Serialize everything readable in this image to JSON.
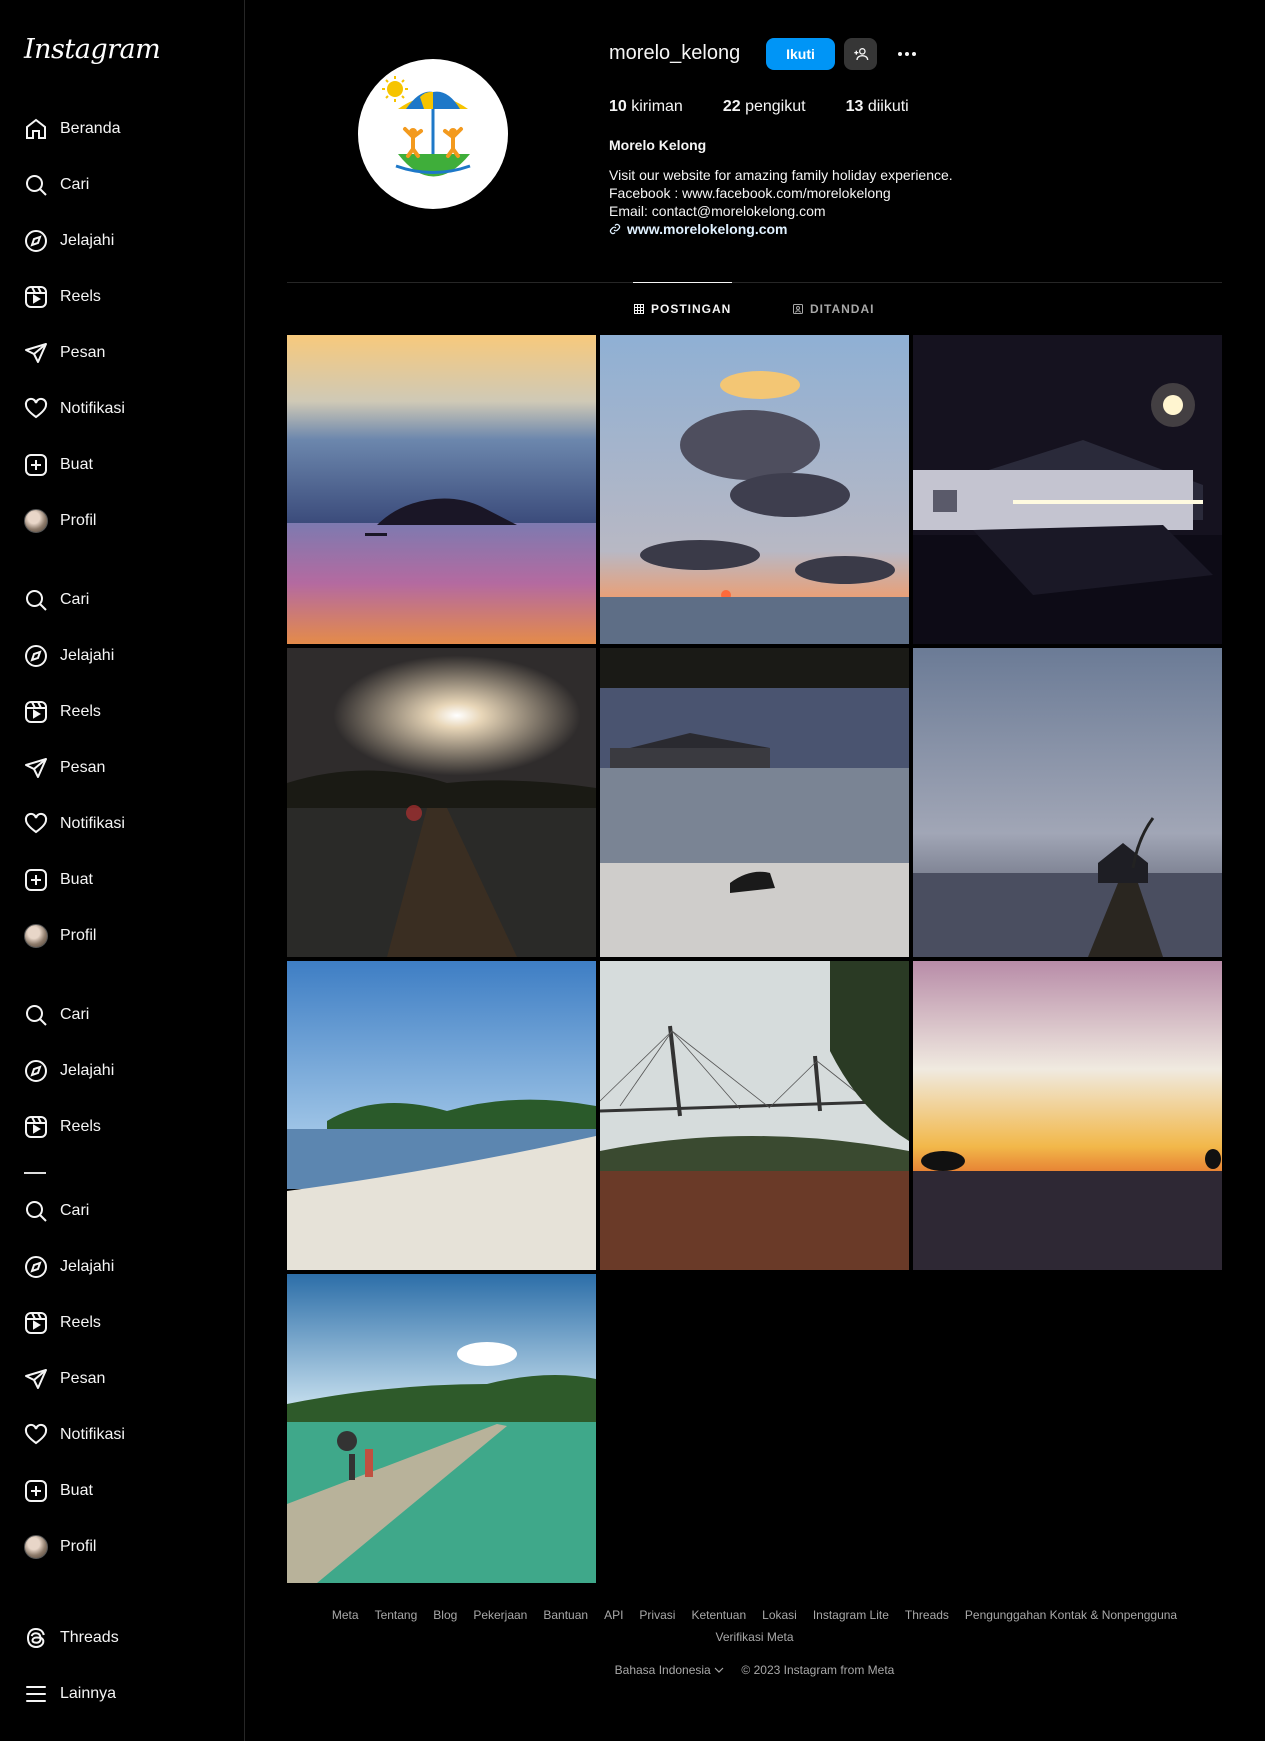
{
  "app": {
    "logo": "Instagram"
  },
  "sidebar": {
    "items": [
      {
        "label": "Beranda",
        "icon": "home-icon"
      },
      {
        "label": "Cari",
        "icon": "search-icon"
      },
      {
        "label": "Jelajahi",
        "icon": "compass-icon"
      },
      {
        "label": "Reels",
        "icon": "reels-icon"
      },
      {
        "label": "Pesan",
        "icon": "send-icon"
      },
      {
        "label": "Notifikasi",
        "icon": "heart-icon"
      },
      {
        "label": "Buat",
        "icon": "plus-square-icon"
      },
      {
        "label": "Profil",
        "icon": "avatar"
      },
      {
        "label": "Cari",
        "icon": "search-icon"
      },
      {
        "label": "Jelajahi",
        "icon": "compass-icon"
      },
      {
        "label": "Reels",
        "icon": "reels-icon"
      },
      {
        "label": "Pesan",
        "icon": "send-icon"
      },
      {
        "label": "Notifikasi",
        "icon": "heart-icon"
      },
      {
        "label": "Buat",
        "icon": "plus-square-icon"
      },
      {
        "label": "Profil",
        "icon": "avatar"
      },
      {
        "label": "Cari",
        "icon": "search-icon"
      },
      {
        "label": "Jelajahi",
        "icon": "compass-icon"
      },
      {
        "label": "Reels",
        "icon": "reels-icon"
      },
      {
        "label": "Cari",
        "icon": "search-icon"
      },
      {
        "label": "Jelajahi",
        "icon": "compass-icon"
      },
      {
        "label": "Reels",
        "icon": "reels-icon"
      },
      {
        "label": "Pesan",
        "icon": "send-icon"
      },
      {
        "label": "Notifikasi",
        "icon": "heart-icon"
      },
      {
        "label": "Buat",
        "icon": "plus-square-icon"
      },
      {
        "label": "Profil",
        "icon": "avatar"
      }
    ],
    "threads": "Threads",
    "more": "Lainnya"
  },
  "profile": {
    "username": "morelo_kelong",
    "follow_label": "Ikuti",
    "posts_count": "10",
    "posts_label": "kiriman",
    "followers_count": "22",
    "followers_label": "pengikut",
    "following_count": "13",
    "following_label": "diikuti",
    "full_name": "Morelo Kelong",
    "bio_line1": "Visit our website for amazing family holiday experience.",
    "bio_line2": "Facebook : www.facebook.com/morelokelong",
    "bio_line3": "Email: contact@morelokelong.com",
    "website": "www.morelokelong.com"
  },
  "tabs": {
    "posts": "POSTINGAN",
    "tagged": "DITANDAI"
  },
  "posts": [
    {
      "desc": "sunset over island silhouette"
    },
    {
      "desc": "clouds over sea at sunset"
    },
    {
      "desc": "lit wooden house at night"
    },
    {
      "desc": "sun over jetty"
    },
    {
      "desc": "stilt houses on beach with dog"
    },
    {
      "desc": "jetty house at dusk"
    },
    {
      "desc": "sandy beach with trees"
    },
    {
      "desc": "cable-stayed bridge"
    },
    {
      "desc": "orange sunset over beach"
    },
    {
      "desc": "long wooden pier over turquoise water"
    }
  ],
  "footer": {
    "links": [
      "Meta",
      "Tentang",
      "Blog",
      "Pekerjaan",
      "Bantuan",
      "API",
      "Privasi",
      "Ketentuan",
      "Lokasi",
      "Instagram Lite",
      "Threads",
      "Pengunggahan Kontak & Nonpengguna",
      "Verifikasi Meta"
    ],
    "language": "Bahasa Indonesia",
    "copyright": "© 2023 Instagram from Meta"
  },
  "colors": {
    "accent": "#0095f6",
    "background": "#000000",
    "text": "#f5f5f5",
    "muted": "#a8a8a8"
  }
}
